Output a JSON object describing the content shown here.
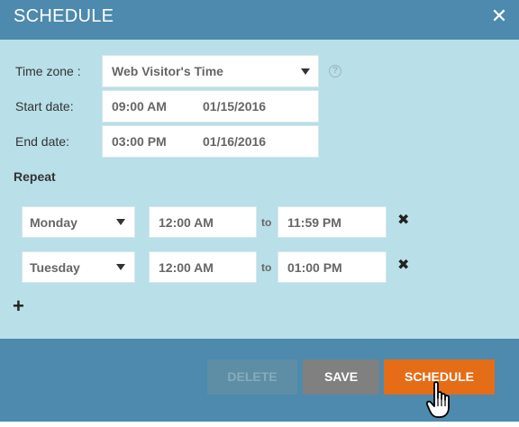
{
  "dialog": {
    "title": "SCHEDULE",
    "close_icon": "close-icon"
  },
  "fields": {
    "timezone_label": "Time zone :",
    "timezone_value": "Web Visitor's Time",
    "start_label": "Start date:",
    "start_time": "09:00 AM",
    "start_date": "01/15/2016",
    "end_label": "End date:",
    "end_time": "03:00 PM",
    "end_date": "01/16/2016"
  },
  "repeat": {
    "label": "Repeat",
    "rows": [
      {
        "day": "Monday",
        "from": "12:00 AM",
        "to_label": "to",
        "to": "11:59 PM"
      },
      {
        "day": "Tuesday",
        "from": "12:00 AM",
        "to_label": "to",
        "to": "01:00 PM"
      }
    ],
    "add_label": "+"
  },
  "footer": {
    "delete_label": "DELETE",
    "save_label": "SAVE",
    "schedule_label": "SCHEDULE"
  },
  "colors": {
    "header": "#4d8aad",
    "body": "#b9dfe8",
    "primary_button": "#e56d18",
    "secondary_button": "#808080"
  }
}
